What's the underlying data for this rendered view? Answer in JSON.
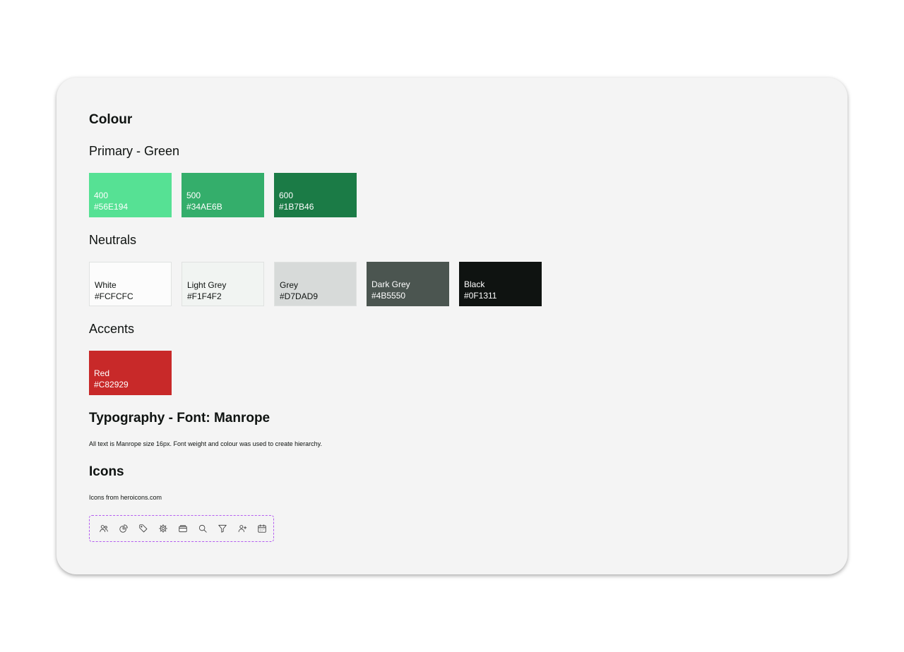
{
  "colour": {
    "title": "Colour",
    "primary": {
      "title": "Primary - Green",
      "swatches": [
        {
          "name": "400",
          "hex": "#56E194",
          "color": "#56E194"
        },
        {
          "name": "500",
          "hex": "#34AE6B",
          "color": "#34AE6B"
        },
        {
          "name": "600",
          "hex": "#1B7B46",
          "color": "#1B7B46"
        }
      ]
    },
    "neutrals": {
      "title": "Neutrals",
      "swatches": [
        {
          "name": "White",
          "hex": "#FCFCFC",
          "color": "#FCFCFC"
        },
        {
          "name": "Light Grey",
          "hex": "#F1F4F2",
          "color": "#F1F4F2"
        },
        {
          "name": "Grey",
          "hex": "#D7DAD9",
          "color": "#D7DAD9"
        },
        {
          "name": "Dark Grey",
          "hex": "#4B5550",
          "color": "#4B5550"
        },
        {
          "name": "Black",
          "hex": "#0F1311",
          "color": "#0F1311"
        }
      ]
    },
    "accents": {
      "title": "Accents",
      "swatches": [
        {
          "name": "Red",
          "hex": "#C82929",
          "color": "#C82929"
        }
      ]
    }
  },
  "typography": {
    "title": "Typography - Font: Manrope",
    "note": "All text is Manrope size 16px. Font weight and colour was used to create hierarchy."
  },
  "icons": {
    "title": "Icons",
    "note": "Icons from heroicons.com",
    "items": [
      "users-icon",
      "chart-pie-icon",
      "tag-icon",
      "cog-icon",
      "wallet-icon",
      "search-icon",
      "funnel-icon",
      "user-plus-icon",
      "calendar-icon"
    ]
  },
  "accent_colors": {
    "icon_box_border": "#B45DF0",
    "card_background": "#F4F4F4"
  }
}
